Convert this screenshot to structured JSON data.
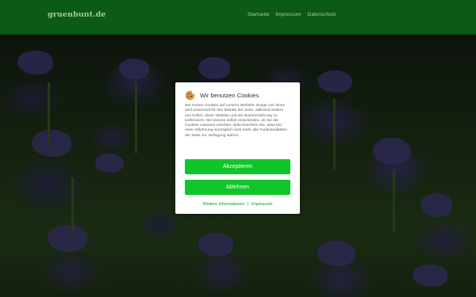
{
  "header": {
    "logo": "gruenbunt.de",
    "nav": [
      {
        "label": "Startseite"
      },
      {
        "label": "Impressum"
      },
      {
        "label": "Datenschutz"
      }
    ]
  },
  "cookie_dialog": {
    "icon": "cookie-icon",
    "title": "Wir benutzen Cookies",
    "text": "Wir nutzen Cookies auf unserer Website. Einige von ihnen sind essenziell für den Betrieb der Seite, während andere uns helfen, diese Website und die Nutzererfahrung zu verbessern. Sie können selbst entscheiden, ob Sie die Cookies zulassen möchten. Bitte beachten Sie, dass bei einer Ablehnung womöglich nicht mehr alle Funktionalitäten der Seite zur Verfügung stehen.",
    "accept_label": "Akzeptieren",
    "decline_label": "Ablehnen",
    "more_info_label": "Weitere Informationen",
    "separator": "|",
    "imprint_label": "Impressum"
  },
  "colors": {
    "header_bg": "#0b5b16",
    "button_green": "#10c52a",
    "link_green": "#10a528"
  }
}
